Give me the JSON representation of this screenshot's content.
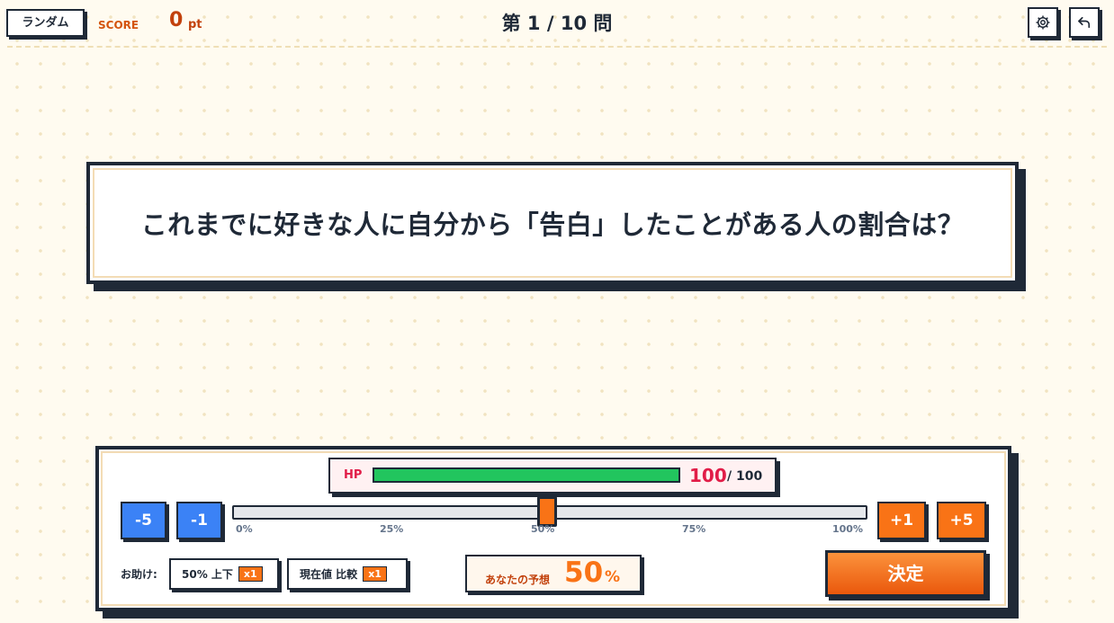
{
  "header": {
    "mode_label": "ランダム",
    "score_label": "SCORE",
    "score_value": "0",
    "score_unit": "pt",
    "question_counter": "第 1 / 10 問",
    "icons": [
      "gear-icon",
      "back-arrow-icon"
    ]
  },
  "question": {
    "text": "これまでに好きな人に自分から「告白」したことがある人の割合は？"
  },
  "hp": {
    "label": "HP",
    "current": "100",
    "max": "/ 100",
    "fraction": 1.0,
    "bar_color": "#22c55e"
  },
  "controls": {
    "minus5": "-5",
    "minus1": "-1",
    "plus1": "+1",
    "plus5": "+5",
    "slider_value": 50,
    "ticks": [
      "0%",
      "25%",
      "50%",
      "75%",
      "100%"
    ]
  },
  "help": {
    "label": "お助け:",
    "items": [
      {
        "label": "50% 上下",
        "count": "x1"
      },
      {
        "label": "現在値 比較",
        "count": "x1"
      }
    ]
  },
  "guess": {
    "label": "あなたの予想",
    "value": "50",
    "unit": "%"
  },
  "submit_label": "決定",
  "colors": {
    "accent_orange": "#f97316",
    "accent_blue": "#3b82f6",
    "hp_red": "#e11d48",
    "ink": "#1f2937",
    "background": "#fffbf0"
  }
}
